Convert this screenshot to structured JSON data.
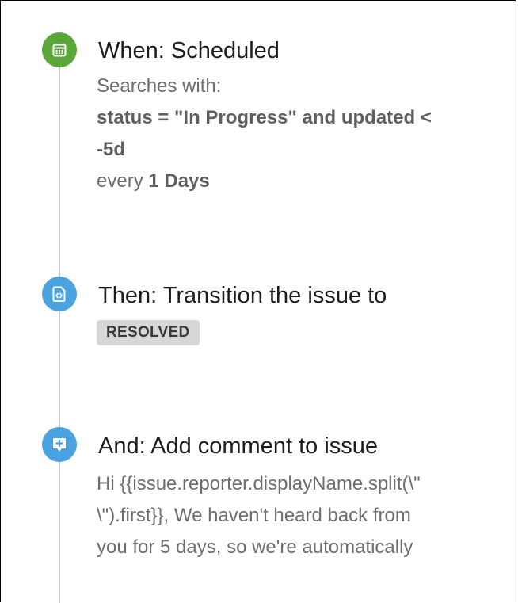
{
  "colors": {
    "trigger_icon_bg": "#5aa83a",
    "action_icon_bg": "#4aa3df",
    "timeline_line": "#c8c8c8",
    "lozenge_bg": "#d7d7d7"
  },
  "steps": [
    {
      "icon": "calendar-icon",
      "title": "When: Scheduled",
      "searches_label": "Searches with:",
      "jql_line1": "status = \"In Progress\" and updated <",
      "jql_line2": "-5d",
      "every_prefix": "every",
      "every_value": "1 Days"
    },
    {
      "icon": "transition-icon",
      "title": "Then: Transition the issue to",
      "status_lozenge": "RESOLVED"
    },
    {
      "icon": "add-comment-icon",
      "title": "And: Add comment to issue",
      "comment_line1": "Hi {{issue.reporter.displayName.split(\\\"",
      "comment_line2": "\\\").first}}, We haven't heard back from",
      "comment_line3": "you for 5 days, so we're automatically"
    }
  ]
}
